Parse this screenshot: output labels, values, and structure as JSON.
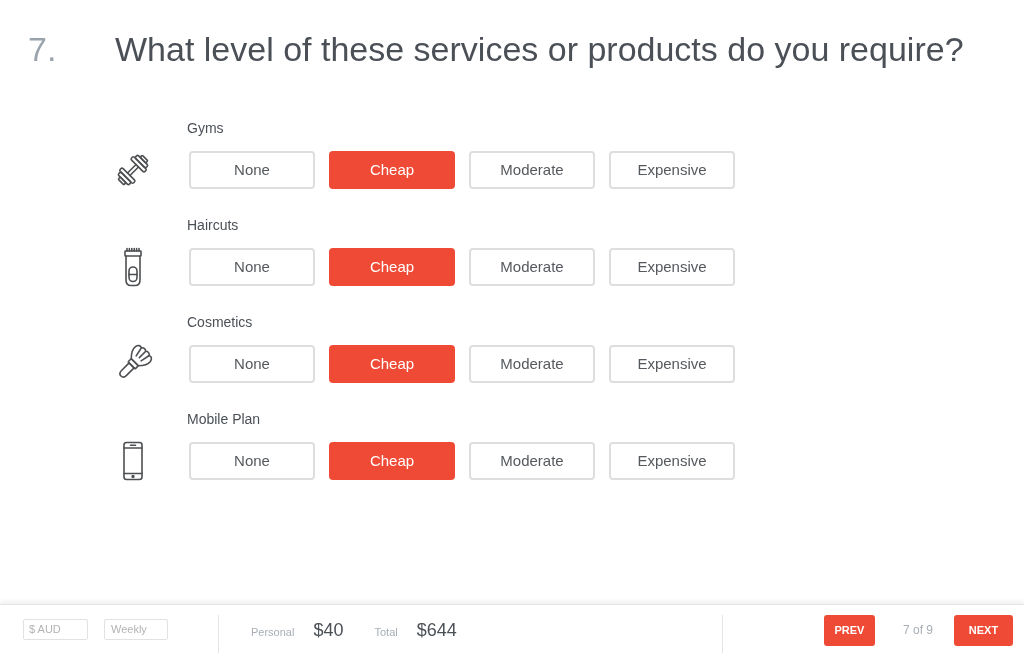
{
  "question": {
    "number": "7.",
    "title": "What level of these services or products do you require?"
  },
  "services": [
    {
      "label": "Gyms",
      "options": [
        {
          "label": "None",
          "selected": false
        },
        {
          "label": "Cheap",
          "selected": true
        },
        {
          "label": "Moderate",
          "selected": false
        },
        {
          "label": "Expensive",
          "selected": false
        }
      ]
    },
    {
      "label": "Haircuts",
      "options": [
        {
          "label": "None",
          "selected": false
        },
        {
          "label": "Cheap",
          "selected": true
        },
        {
          "label": "Moderate",
          "selected": false
        },
        {
          "label": "Expensive",
          "selected": false
        }
      ]
    },
    {
      "label": "Cosmetics",
      "options": [
        {
          "label": "None",
          "selected": false
        },
        {
          "label": "Cheap",
          "selected": true
        },
        {
          "label": "Moderate",
          "selected": false
        },
        {
          "label": "Expensive",
          "selected": false
        }
      ]
    },
    {
      "label": "Mobile Plan",
      "options": [
        {
          "label": "None",
          "selected": false
        },
        {
          "label": "Cheap",
          "selected": true
        },
        {
          "label": "Moderate",
          "selected": false
        },
        {
          "label": "Expensive",
          "selected": false
        }
      ]
    }
  ],
  "footer": {
    "currency_field": {
      "placeholder": "$ AUD"
    },
    "period_field": {
      "placeholder": "Weekly"
    },
    "totals": [
      {
        "label": "Personal",
        "amount": "$40"
      },
      {
        "label": "Total",
        "amount": "$644"
      }
    ],
    "pager": {
      "prev": "PREV",
      "position": "7 of 9",
      "next": "NEXT"
    }
  }
}
